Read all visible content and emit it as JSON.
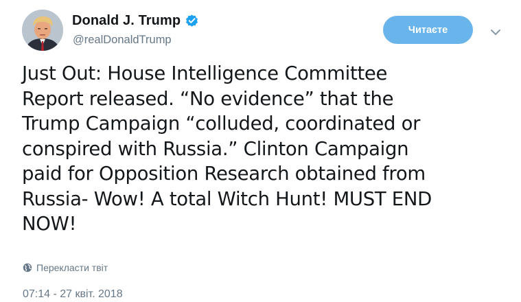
{
  "author": {
    "display_name": "Donald J. Trump",
    "handle": "@realDonaldTrump",
    "verified_icon": "verified-badge-icon",
    "avatar_icon": "profile-photo"
  },
  "follow_button": {
    "label": "Читаєте"
  },
  "menu": {
    "icon": "chevron-down-icon"
  },
  "tweet": {
    "text": "Just Out: House Intelligence Committee\nReport released. “No evidence” that the\nTrump Campaign “colluded, coordinated or\nconspired with Russia.” Clinton Campaign\npaid for Opposition Research obtained from\nRussia- Wow! A total Witch Hunt! MUST END\nNOW!"
  },
  "translate": {
    "label": "Перекласти твіт",
    "icon": "globe-icon"
  },
  "timestamp": "07:14 - 27 квіт. 2018",
  "colors": {
    "accent": "#1da1f2",
    "follow_bg": "#6ab4ec",
    "secondary_text": "#657786",
    "primary_text": "#14171a"
  }
}
